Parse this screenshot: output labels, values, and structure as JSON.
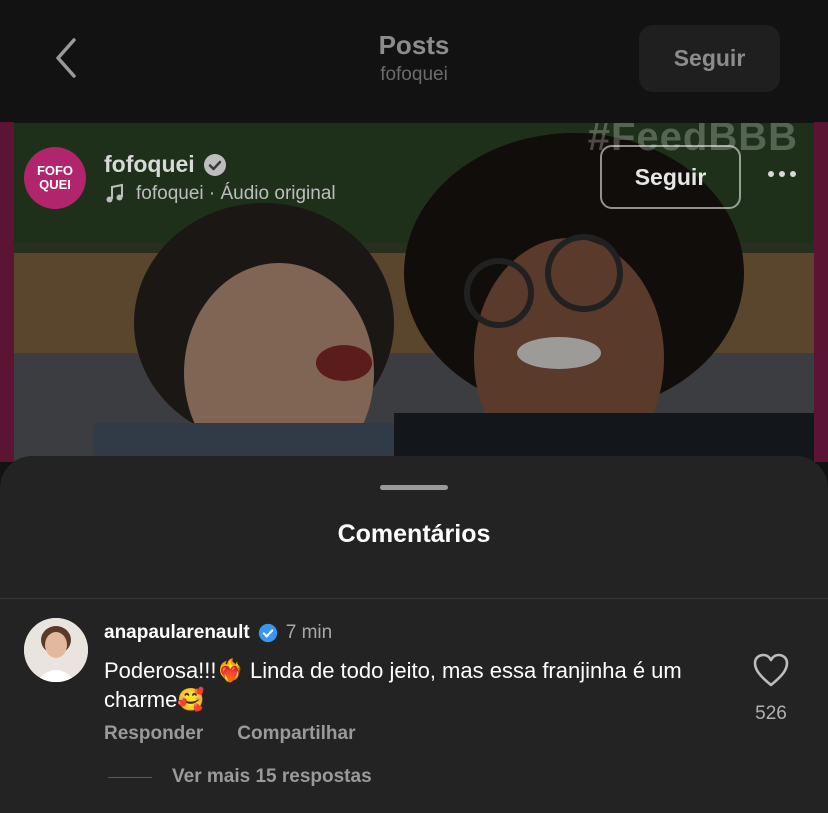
{
  "header": {
    "title": "Posts",
    "subtitle": "fofoquei",
    "follow_label": "Seguir"
  },
  "media": {
    "hashtag": "#FeedBBB",
    "logo_line1": "FOFO",
    "logo_line2": "QUEI",
    "account": "fofoquei",
    "audio_text": "fofoquei · Áudio original",
    "follow_label": "Seguir"
  },
  "sheet": {
    "title": "Comentários"
  },
  "comment": {
    "username": "anapaularenault",
    "time": "7 min",
    "text": "Poderosa!!!❤️‍🔥 Linda de todo jeito, mas essa franjinha é um charme🥰",
    "reply_label": "Responder",
    "share_label": "Compartilhar",
    "likes": "526",
    "view_replies": "Ver mais 15 respostas"
  },
  "colors": {
    "background": "#121212",
    "sheet": "#232323",
    "brand_pink": "#b0256b",
    "verified_blue": "#3897f0"
  }
}
